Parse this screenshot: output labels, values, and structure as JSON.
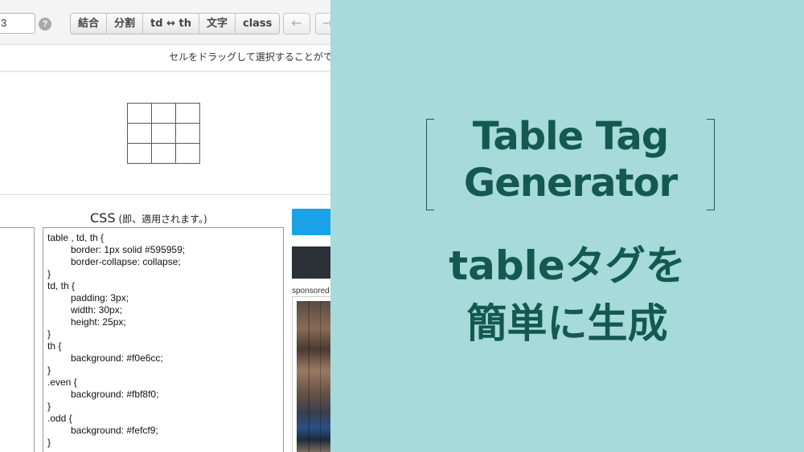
{
  "toolbar": {
    "size_value": "3",
    "help_symbol": "?",
    "buttons": [
      "結合",
      "分割",
      "td ↔ th",
      "文字",
      "class"
    ],
    "undo_symbol": "←",
    "redo_symbol": "→"
  },
  "hint": "セルをドラッグして選択することができます",
  "css_heading": {
    "main": "CSS",
    "note": "(即、適用されます。)"
  },
  "css_code": [
    {
      "text": "table , td, th {",
      "indent": false
    },
    {
      "text": "border: 1px solid #595959;",
      "indent": true
    },
    {
      "text": "border-collapse: collapse;",
      "indent": true
    },
    {
      "text": "}",
      "indent": false
    },
    {
      "text": "td, th {",
      "indent": false
    },
    {
      "text": "padding: 3px;",
      "indent": true
    },
    {
      "text": "width: 30px;",
      "indent": true
    },
    {
      "text": "height: 25px;",
      "indent": true
    },
    {
      "text": "}",
      "indent": false
    },
    {
      "text": "th {",
      "indent": false
    },
    {
      "text": "background: #f0e6cc;",
      "indent": true
    },
    {
      "text": "}",
      "indent": false
    },
    {
      "text": ".even {",
      "indent": false
    },
    {
      "text": "background: #fbf8f0;",
      "indent": true
    },
    {
      "text": "}",
      "indent": false
    },
    {
      "text": ".odd {",
      "indent": false
    },
    {
      "text": "background: #fefcf9;",
      "indent": true
    },
    {
      "text": "}",
      "indent": false
    }
  ],
  "sidebar": {
    "sponsored_label": "sponsored"
  },
  "title": {
    "en_line1": "Table Tag",
    "en_line2": "Generator",
    "jp_line1": "tableタグを",
    "jp_line2": "簡単に生成"
  },
  "colors": {
    "panel_background": "#a6dadb",
    "title_text": "#13594f",
    "accent_blue": "#1aa2e8",
    "table_border": "#595959"
  }
}
